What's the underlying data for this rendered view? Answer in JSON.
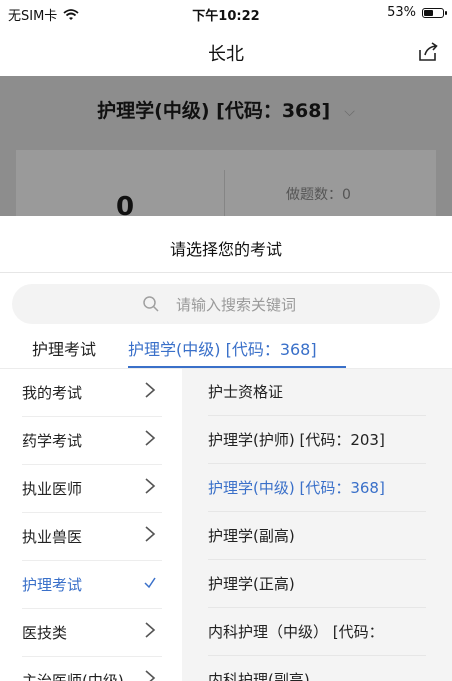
{
  "status_bar": {
    "carrier": "无SIM卡",
    "time": "下午10:22",
    "battery": "53%",
    "battery_level": 0.53
  },
  "nav": {
    "title": "长北",
    "share_icon": "share-icon"
  },
  "background_page": {
    "exam_name": "护理学(中级) [代码：368]",
    "score": "0",
    "question_count": "做题数：0"
  },
  "sheet": {
    "title": "请选择您的考试",
    "search_placeholder": "请输入搜索关键词",
    "tabs": [
      {
        "label": "护理考试"
      },
      {
        "label": "护理学(中级) [代码：368]"
      }
    ],
    "categories": [
      {
        "label": "我的考试"
      },
      {
        "label": "药学考试"
      },
      {
        "label": "执业医师"
      },
      {
        "label": "执业兽医"
      },
      {
        "label": "护理考试"
      },
      {
        "label": "医技类"
      },
      {
        "label": "主治医师(中级)"
      }
    ],
    "exams": [
      {
        "label": "护士资格证"
      },
      {
        "label": "护理学(护师) [代码：203]"
      },
      {
        "label": "护理学(中级) [代码：368]"
      },
      {
        "label": "护理学(副高)"
      },
      {
        "label": "护理学(正高)"
      },
      {
        "label": "内科护理（中级） [代码："
      },
      {
        "label": "内科护理(副高)"
      }
    ]
  },
  "colors": {
    "accent": "#3a70c9",
    "overlay": "#8d8d8d"
  }
}
